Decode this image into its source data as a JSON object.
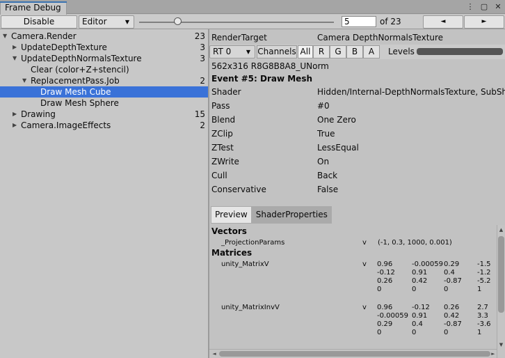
{
  "window": {
    "tab_title": "Frame Debug",
    "icons": [
      "menu-dots-icon",
      "maximize-icon",
      "close-icon"
    ]
  },
  "toolbar": {
    "disable_label": "Disable",
    "target_dropdown": "Editor",
    "event_index": "5",
    "event_total": "of 23",
    "prev_label": "◄",
    "next_label": "►"
  },
  "tree": [
    {
      "label": "Camera.Render",
      "count": "23",
      "depth": 0,
      "expanded": true
    },
    {
      "label": "UpdateDepthTexture",
      "count": "3",
      "depth": 1,
      "expanded": false
    },
    {
      "label": "UpdateDepthNormalsTexture",
      "count": "3",
      "depth": 1,
      "expanded": true
    },
    {
      "label": "Clear (color+Z+stencil)",
      "count": "",
      "depth": 2,
      "expanded": null
    },
    {
      "label": "ReplacementPass.Job",
      "count": "2",
      "depth": 2,
      "expanded": true
    },
    {
      "label": "Draw Mesh Cube",
      "count": "",
      "depth": 3,
      "expanded": null,
      "selected": true
    },
    {
      "label": "Draw Mesh Sphere",
      "count": "",
      "depth": 3,
      "expanded": null
    },
    {
      "label": "Drawing",
      "count": "15",
      "depth": 1,
      "expanded": false
    },
    {
      "label": "Camera.ImageEffects",
      "count": "2",
      "depth": 1,
      "expanded": false
    }
  ],
  "details": {
    "render_target_label": "RenderTarget",
    "render_target_value": "Camera DepthNormalsTexture",
    "rt_dropdown": "RT 0",
    "channels_label": "Channels",
    "channels": [
      "All",
      "R",
      "G",
      "B",
      "A"
    ],
    "active_channel": "All",
    "levels_label": "Levels",
    "format": "562x316 R8G8B8A8_UNorm",
    "event_title": "Event #5: Draw Mesh",
    "fields": [
      {
        "label": "Shader",
        "value": "Hidden/Internal-DepthNormalsTexture, SubShader"
      },
      {
        "label": "Pass",
        "value": "#0"
      },
      {
        "label": "Blend",
        "value": "One Zero"
      },
      {
        "label": "ZClip",
        "value": "True"
      },
      {
        "label": "ZTest",
        "value": "LessEqual"
      },
      {
        "label": "ZWrite",
        "value": "On"
      },
      {
        "label": "Cull",
        "value": "Back"
      },
      {
        "label": "Conservative",
        "value": "False"
      }
    ]
  },
  "subtabs": {
    "preview": "Preview",
    "shader_properties": "ShaderProperties"
  },
  "properties": {
    "vectors_header": "Vectors",
    "vectors": [
      {
        "name": "_ProjectionParams",
        "type": "v",
        "value": "(-1, 0.3, 1000, 0.001)"
      }
    ],
    "matrices_header": "Matrices",
    "matrices": [
      {
        "name": "unity_MatrixV",
        "type": "v",
        "rows": [
          [
            "0.96",
            "-0.00059",
            "0.29",
            "-1.5"
          ],
          [
            "-0.12",
            "0.91",
            "0.4",
            "-1.2"
          ],
          [
            "0.26",
            "0.42",
            "-0.87",
            "-5.2"
          ],
          [
            "0",
            "0",
            "0",
            "1"
          ]
        ]
      },
      {
        "name": "unity_MatrixInvV",
        "type": "v",
        "rows": [
          [
            "0.96",
            "-0.12",
            "0.26",
            "2.7"
          ],
          [
            "-0.00059",
            "0.91",
            "0.42",
            "3.3"
          ],
          [
            "0.29",
            "0.4",
            "-0.87",
            "-3.6"
          ],
          [
            "0",
            "0",
            "0",
            "1"
          ]
        ]
      }
    ]
  }
}
